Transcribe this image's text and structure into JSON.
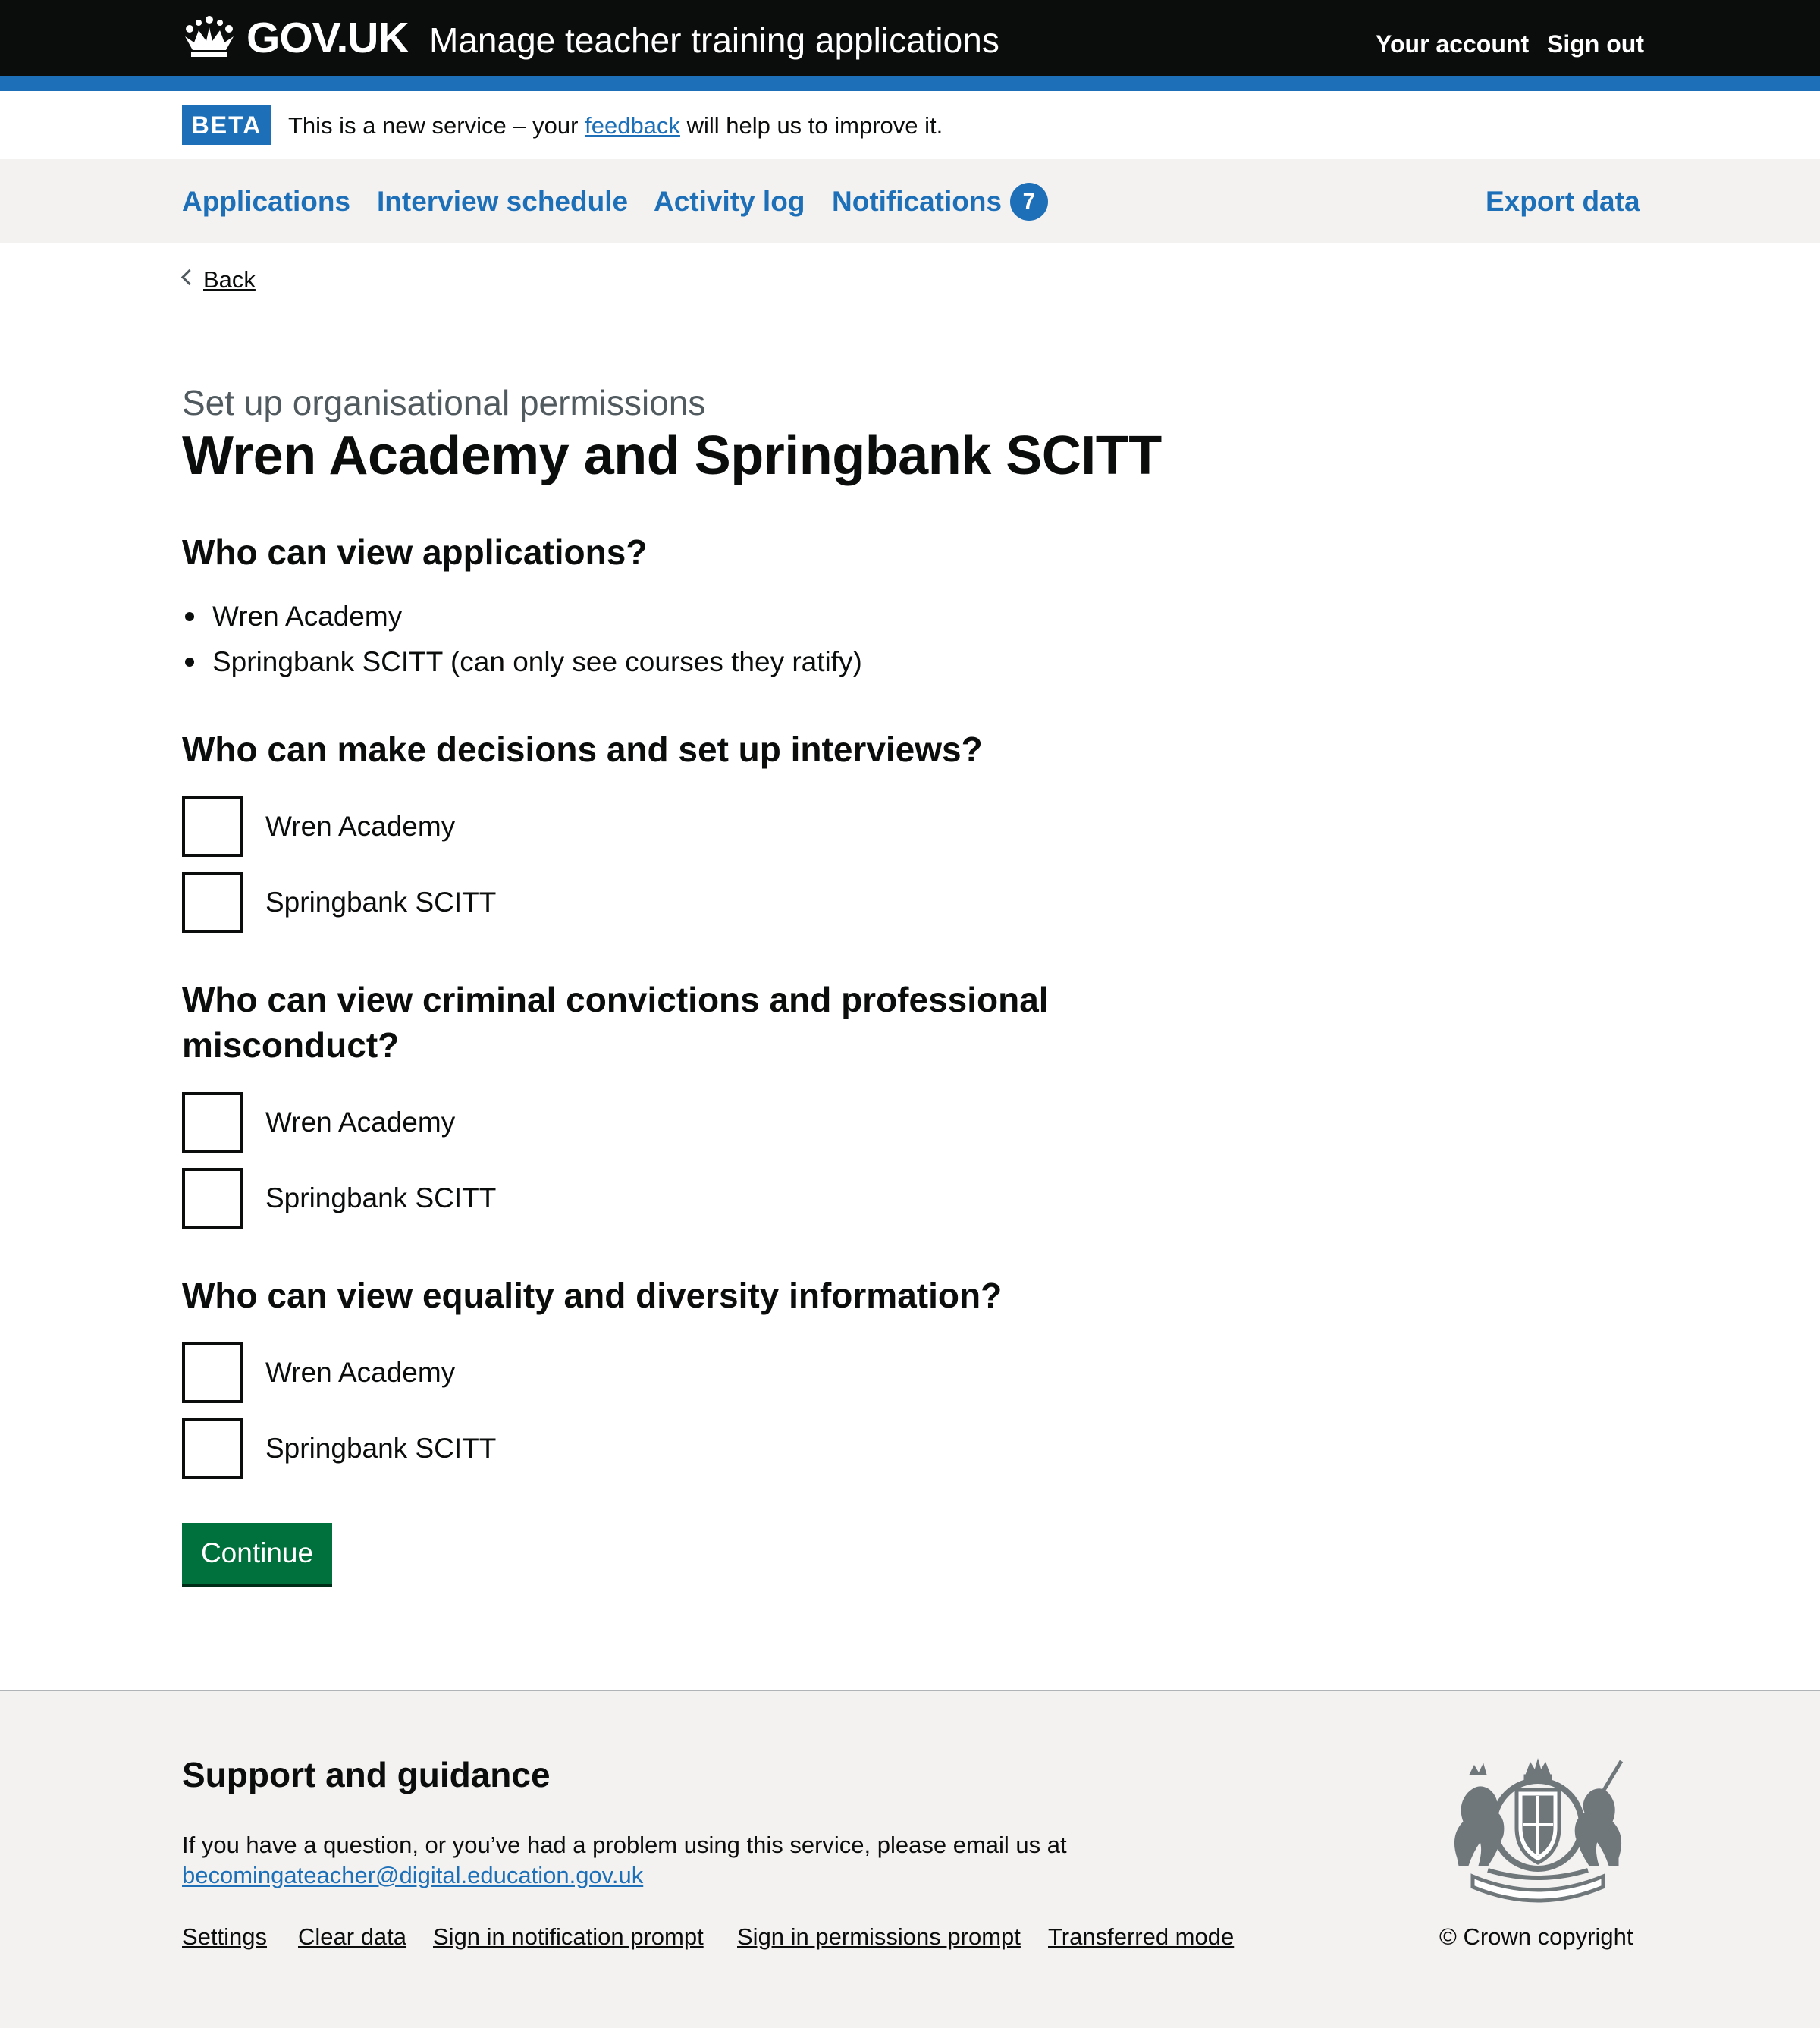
{
  "header": {
    "logo_text": "GOV.UK",
    "service_name": "Manage teacher training applications",
    "links": [
      "Your account",
      "Sign out"
    ]
  },
  "phase_banner": {
    "tag": "BETA",
    "text_before": "This is a new service – your",
    "link": "feedback",
    "text_after": "will help us to improve it."
  },
  "nav": {
    "items": [
      "Applications",
      "Interview schedule",
      "Activity log",
      "Notifications"
    ],
    "notification_count": "7",
    "export": "Export data"
  },
  "back_link": "Back",
  "main": {
    "caption": "Set up organisational permissions",
    "title": "Wren Academy and Springbank SCITT",
    "view_applications": {
      "heading": "Who can view applications?",
      "items": [
        "Wren Academy",
        "Springbank SCITT (can only see courses they ratify)"
      ]
    },
    "groups": [
      {
        "heading": "Who can make decisions and set up interviews?",
        "options": [
          "Wren Academy",
          "Springbank SCITT"
        ]
      },
      {
        "heading": "Who can view criminal convictions and professional misconduct?",
        "options": [
          "Wren Academy",
          "Springbank SCITT"
        ]
      },
      {
        "heading": "Who can view equality and diversity information?",
        "options": [
          "Wren Academy",
          "Springbank SCITT"
        ]
      }
    ],
    "continue_label": "Continue"
  },
  "footer": {
    "heading": "Support and guidance",
    "text": "If you have a question, or you’ve had a problem using this service, please email us at",
    "email": "becomingateacher@digital.education.gov.uk",
    "links": [
      "Settings",
      "Clear data",
      "Sign in notification prompt",
      "Sign in permissions prompt",
      "Transferred mode"
    ],
    "copyright": "© Crown copyright"
  },
  "colors": {
    "brand_blue": "#1d70b8",
    "header_black": "#0b0c0c",
    "button_green": "#00703c",
    "footer_grey": "#f3f2f1"
  },
  "icons": [
    "crown-icon",
    "chevron-left-icon",
    "royal-coat-of-arms-icon"
  ]
}
